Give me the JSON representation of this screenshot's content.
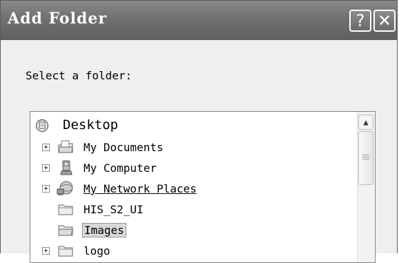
{
  "window": {
    "title": "Add Folder",
    "help_label": "?",
    "close_label": "✕"
  },
  "prompt": "Select a folder:",
  "tree": {
    "items": [
      {
        "label": "Desktop",
        "icon": "desktop-icon",
        "expander": ""
      },
      {
        "label": "My Documents",
        "icon": "my-documents-icon",
        "expander": "+"
      },
      {
        "label": "My Computer",
        "icon": "my-computer-icon",
        "expander": "+"
      },
      {
        "label": "My Network Places",
        "icon": "network-places-icon",
        "expander": "+"
      },
      {
        "label": "HIS_S2_UI",
        "icon": "folder-icon",
        "expander": ""
      },
      {
        "label": "Images",
        "icon": "folder-icon",
        "expander": "",
        "selected": true
      },
      {
        "label": "logo",
        "icon": "folder-icon",
        "expander": "+"
      }
    ]
  },
  "colors": {
    "titlebar": "#707070",
    "background": "#efefef",
    "selection": "#d8d8d8"
  }
}
